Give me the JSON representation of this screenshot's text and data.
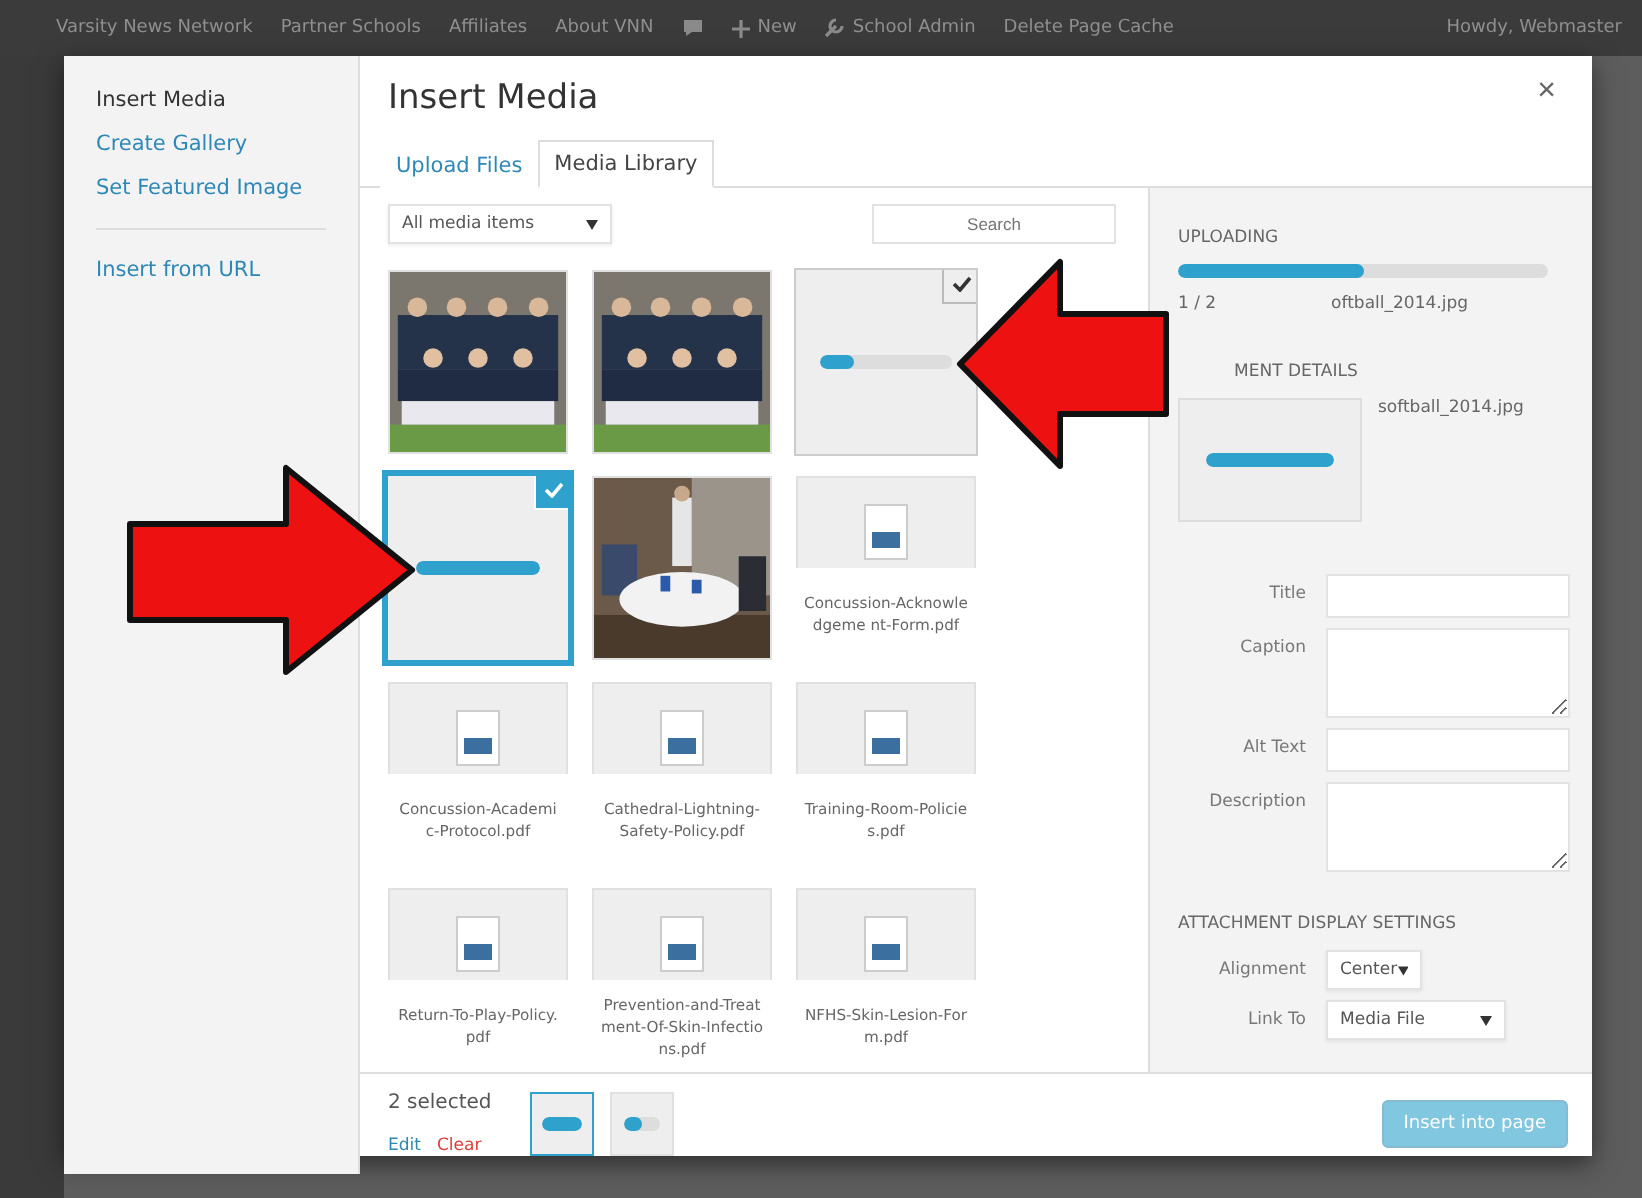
{
  "admin_bar": {
    "items": [
      {
        "kind": "text",
        "label": "Varsity News Network"
      },
      {
        "kind": "text",
        "label": "Partner Schools"
      },
      {
        "kind": "text",
        "label": "Affiliates"
      },
      {
        "kind": "text",
        "label": "About VNN"
      },
      {
        "kind": "comments"
      },
      {
        "kind": "new",
        "label": "New"
      },
      {
        "kind": "tool",
        "label": "School Admin"
      },
      {
        "kind": "text",
        "label": "Delete Page Cache"
      }
    ],
    "greeting": "Howdy, Webmaster"
  },
  "modal": {
    "close": "×",
    "menu_groups": [
      [
        {
          "label": "Insert Media",
          "selected": true
        },
        {
          "label": "Create Gallery",
          "selected": false
        },
        {
          "label": "Set Featured Image",
          "selected": false
        }
      ],
      [
        {
          "label": "Insert from URL",
          "selected": false
        }
      ]
    ],
    "title": "Insert Media",
    "tabs": [
      {
        "label": "Upload Files",
        "selected": false
      },
      {
        "label": "Media Library",
        "selected": true
      }
    ],
    "filter": "All media items",
    "search": {
      "placeholder": "Search"
    },
    "items": [
      {
        "kind": "group_photo",
        "selected": false,
        "active": false
      },
      {
        "kind": "group_photo",
        "selected": false,
        "active": false
      },
      {
        "kind": "uploading",
        "level": 0.25,
        "selected": true,
        "active": false
      },
      {
        "kind": "uploading",
        "level": 1,
        "selected": true,
        "active": true
      },
      {
        "kind": "event_photo",
        "selected": false,
        "active": false
      },
      {
        "kind": "document",
        "name": "Concussion-Acknowledgeme nt-Form.pdf",
        "selected": false,
        "active": false
      },
      {
        "kind": "document",
        "name": "Concussion-Academic-Protocol.pdf",
        "selected": false,
        "active": false
      },
      {
        "kind": "document",
        "name": "Cathedral-Lightning-Safety-Policy.pdf",
        "selected": false,
        "active": false
      },
      {
        "kind": "document",
        "name": "Training-Room-Policies.pdf",
        "selected": false,
        "active": false
      },
      {
        "kind": "document",
        "name": "Return-To-Play-Policy.pdf",
        "selected": false,
        "active": false
      },
      {
        "kind": "document",
        "name": "Prevention-and-Treatment-Of-Skin-Infections.pdf",
        "selected": false,
        "active": false
      },
      {
        "kind": "document",
        "name": "NFHS-Skin-Lesion-Form.pdf",
        "selected": false,
        "active": false
      }
    ],
    "sidebar": {
      "uploading_heading": "UPLOADING",
      "upload": {
        "level": 0.5
      },
      "upload_count": "1 / 2",
      "upload_file": "oftball_2014.jpg",
      "details_heading": "MENT DETAILS",
      "details_file": "softball_2014.jpg",
      "thumbnail": {
        "level": 1
      },
      "fields": [
        {
          "label": "Title",
          "kind": "input"
        },
        {
          "label": "Caption",
          "kind": "textarea"
        },
        {
          "label": "Alt Text",
          "kind": "input"
        },
        {
          "label": "Description",
          "kind": "textarea"
        }
      ],
      "settings_heading": "ATTACHMENT DISPLAY SETTINGS",
      "settings": [
        {
          "label": "Alignment",
          "value": "Center"
        },
        {
          "label": "Link To",
          "value": "Media File"
        }
      ]
    },
    "selection": {
      "count": "2 selected",
      "edit": "Edit",
      "clear": "Clear",
      "thumbs": [
        {
          "level": 1,
          "selected": true
        },
        {
          "level": 0.5,
          "selected": false
        }
      ]
    },
    "insert_button": {
      "label": "Insert into page",
      "disabled": true
    }
  }
}
